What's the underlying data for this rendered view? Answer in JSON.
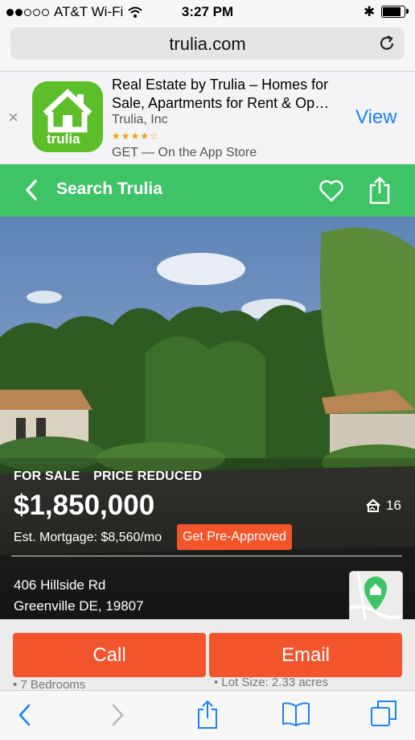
{
  "status_bar": {
    "carrier": "AT&T Wi-Fi",
    "time": "3:27 PM",
    "signal_bars": 2,
    "bluetooth": "✱",
    "battery_level": 0.8
  },
  "browser": {
    "url": "trulia.com"
  },
  "app_banner": {
    "close": "×",
    "logo_text": "trulia",
    "app_name": "Real Estate by Trulia – Homes for Sale, Apartments for Rent & Op…",
    "developer": "Trulia, Inc",
    "stars": "★★★★☆",
    "rating": 4,
    "get_text": "GET — On the App Store",
    "view_label": "View"
  },
  "header": {
    "title": "Search Trulia"
  },
  "listing": {
    "tag_for_sale": "FOR SALE",
    "tag_price_reduced": "PRICE REDUCED",
    "price": "$1,850,000",
    "photo_count": "16",
    "mortgage": "Est. Mortgage: $8,560/mo",
    "preapproved_label": "Get Pre-Approved",
    "address_line1": "406 Hillside Rd",
    "address_line2": "Greenville DE, 19807"
  },
  "actions": {
    "call_label": "Call",
    "email_label": "Email"
  },
  "facts": {
    "bedrooms": "7 Bedrooms",
    "lot_size": "Lot Size: 2.33 acres"
  },
  "colors": {
    "trulia_green": "#3ec366",
    "cta_orange": "#f2552c",
    "ios_blue": "#1a82fb"
  }
}
